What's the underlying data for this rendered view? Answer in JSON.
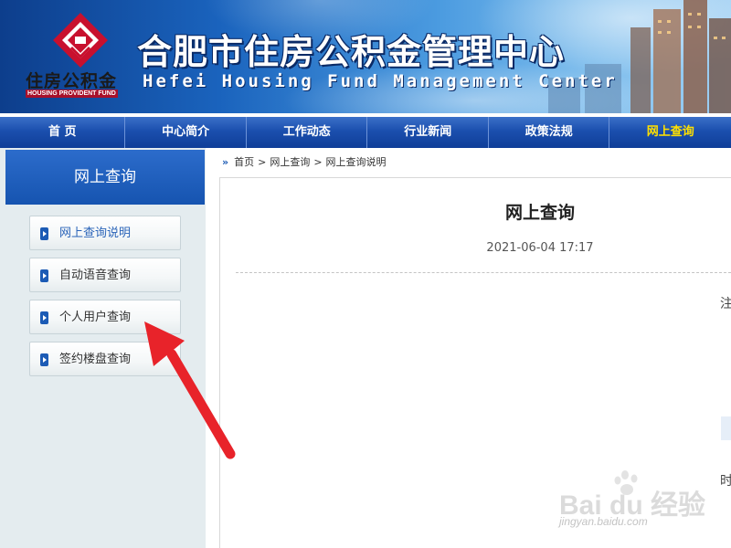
{
  "header": {
    "logo_text_cn": "住房公积金",
    "logo_text_en": "HOUSING PROVIDENT FUND",
    "title_cn": "合肥市住房公积金管理中心",
    "title_en": "Hefei Housing Fund Management Center"
  },
  "nav": {
    "items": [
      {
        "label": "首 页"
      },
      {
        "label": "中心简介"
      },
      {
        "label": "工作动态"
      },
      {
        "label": "行业新闻"
      },
      {
        "label": "政策法规"
      },
      {
        "label": "网上查询"
      }
    ],
    "active": "网上查询"
  },
  "sidebar": {
    "title": "网上查询",
    "items": [
      {
        "label": "网上查询说明"
      },
      {
        "label": "自动语音查询"
      },
      {
        "label": "个人用户查询"
      },
      {
        "label": "签约楼盘查询"
      }
    ]
  },
  "breadcrumb": {
    "items": [
      "首页",
      "网上查询",
      "网上查询说明"
    ],
    "separator": ">"
  },
  "article": {
    "title": "网上查询",
    "date": "2021-06-04 17:17",
    "edge_char_1": "注",
    "edge_char_2": "时"
  },
  "watermark": {
    "main": "Bai du 经验",
    "sub": "jingyan.baidu.com"
  },
  "colors": {
    "nav_blue": "#1b4fae",
    "active_nav": "#ffe000",
    "logo_red": "#c8102e",
    "arrow_red": "#e8232a"
  }
}
